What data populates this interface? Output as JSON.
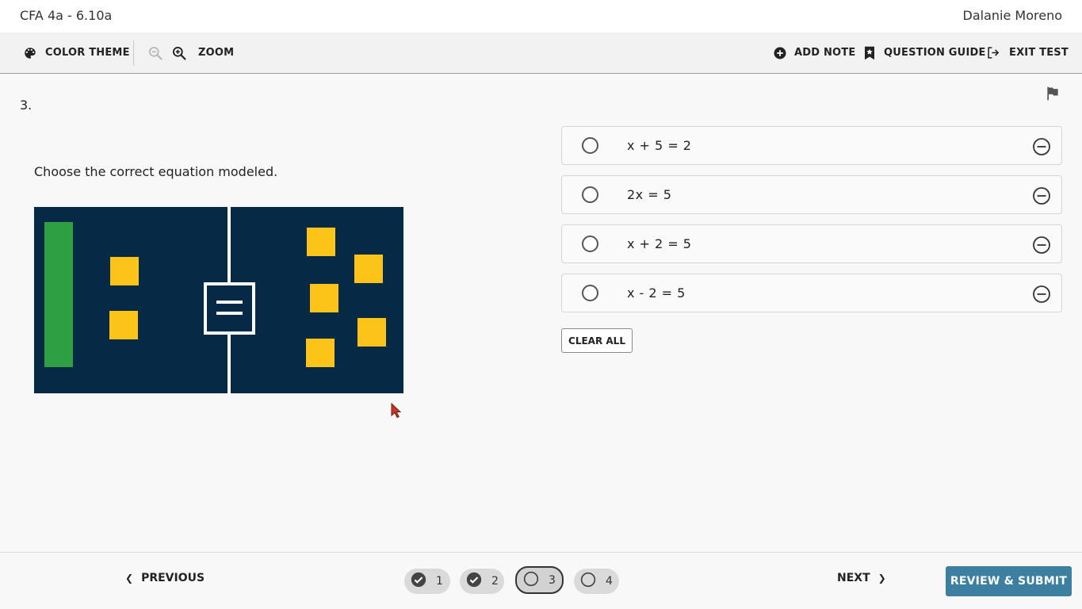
{
  "header": {
    "test_name": "CFA 4a - 6.10a",
    "user_name": "Dalanie Moreno"
  },
  "toolbar": {
    "color_theme_label": "COLOR THEME",
    "zoom_label": "ZOOM",
    "add_note_label": "ADD NOTE",
    "question_guide_label": "QUESTION GUIDE",
    "exit_test_label": "EXIT TEST",
    "icons": [
      "palette-icon",
      "zoom-out-icon",
      "zoom-in-icon",
      "add-circle-icon",
      "bookmark-star-icon",
      "exit-icon"
    ]
  },
  "question": {
    "number": "3.",
    "prompt": "Choose the correct equation modeled.",
    "image": {
      "background": "#062a45",
      "variable_tile_color": "#2ea043",
      "unit_tile_color": "#fcc419",
      "left_unit_tiles": 2,
      "left_variable_tiles": 1,
      "right_unit_tiles": 5
    }
  },
  "choices": [
    {
      "text": "x + 5 = 2"
    },
    {
      "text": "2x = 5"
    },
    {
      "text": "x + 2 = 5"
    },
    {
      "text": "x - 2 = 5"
    }
  ],
  "clear_all_label": "CLEAR ALL",
  "footer": {
    "previous_label": "PREVIOUS",
    "next_label": "NEXT",
    "review_label": "REVIEW & SUBMIT",
    "pages": [
      {
        "number": "1",
        "status": "answered"
      },
      {
        "number": "2",
        "status": "answered"
      },
      {
        "number": "3",
        "status": "current"
      },
      {
        "number": "4",
        "status": "unanswered"
      }
    ]
  },
  "colors": {
    "accent": "#3c7fa0",
    "toolbar_bg": "#f2f2f2",
    "page_bg": "#f8f8f8"
  }
}
